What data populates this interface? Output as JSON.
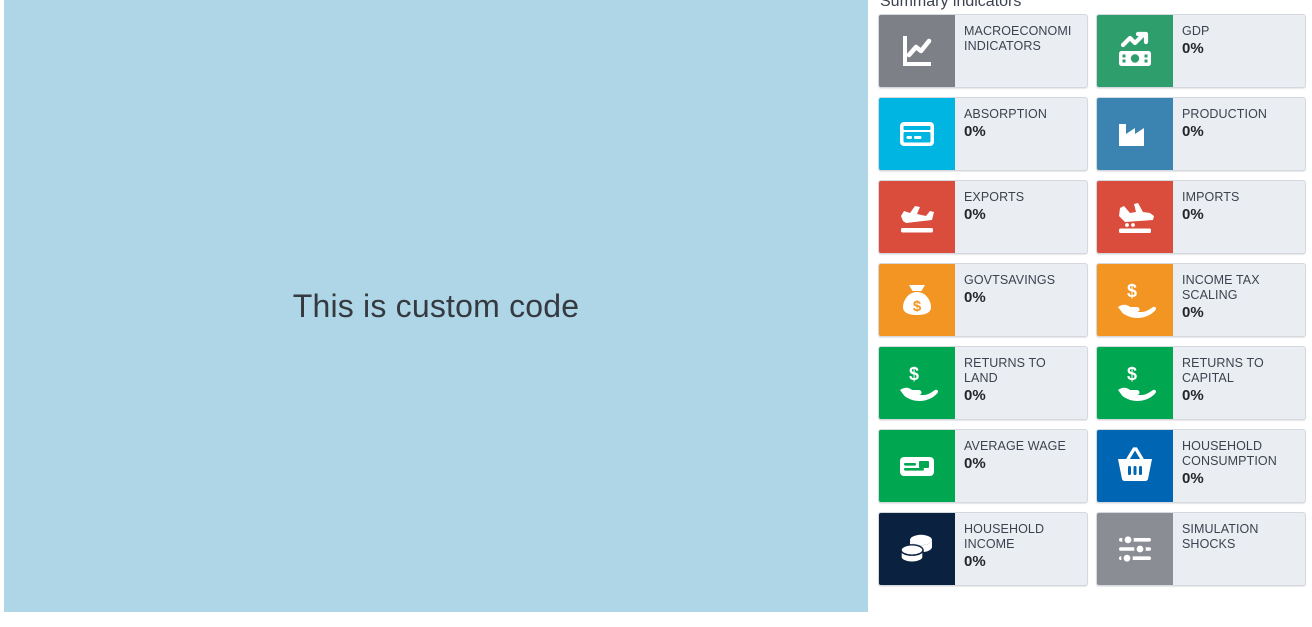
{
  "custom_panel": {
    "text": "This is custom code",
    "background": "#aed6e6"
  },
  "summary": {
    "title": "Summary indicators",
    "tiles": [
      {
        "id": "macroeconomic-indicators",
        "label": "MACROECONOMI\nINDICATORS",
        "value": "",
        "icon": "line-chart-icon",
        "color": "#7d8087"
      },
      {
        "id": "gdp",
        "label": "GDP",
        "value": "0%",
        "icon": "money-bill-trend-icon",
        "color": "#2e9e6c"
      },
      {
        "id": "absorption",
        "label": "ABSORPTION",
        "value": "0%",
        "icon": "credit-card-icon",
        "color": "#00b5e2"
      },
      {
        "id": "production",
        "label": "PRODUCTION",
        "value": "0%",
        "icon": "factory-icon",
        "color": "#3b83b0"
      },
      {
        "id": "exports",
        "label": "EXPORTS",
        "value": "0%",
        "icon": "plane-departure-icon",
        "color": "#da4c3c"
      },
      {
        "id": "imports",
        "label": "IMPORTS",
        "value": "0%",
        "icon": "plane-arrival-icon",
        "color": "#da4c3c"
      },
      {
        "id": "govtsavings",
        "label": "GOVTSAVINGS",
        "value": "0%",
        "icon": "money-bag-icon",
        "color": "#f29523"
      },
      {
        "id": "income-tax-scaling",
        "label": "INCOME TAX\nSCALING",
        "value": "0%",
        "icon": "hand-holding-dollar-icon",
        "color": "#f29523"
      },
      {
        "id": "returns-to-land",
        "label": "RETURNS TO\nLAND",
        "value": "0%",
        "icon": "hand-holding-dollar-icon",
        "color": "#00a650"
      },
      {
        "id": "returns-to-capital",
        "label": "RETURNS TO\nCAPITAL",
        "value": "0%",
        "icon": "hand-holding-dollar-icon",
        "color": "#00a650"
      },
      {
        "id": "average-wage",
        "label": "AVERAGE WAGE",
        "value": "0%",
        "icon": "id-card-icon",
        "color": "#00a650"
      },
      {
        "id": "household-consumption",
        "label": "HOUSEHOLD\nCONSUMPTION",
        "value": "0%",
        "icon": "shopping-basket-icon",
        "color": "#0066b3"
      },
      {
        "id": "household-income",
        "label": "HOUSEHOLD\nINCOME",
        "value": "0%",
        "icon": "coins-stack-icon",
        "color": "#0a2240"
      },
      {
        "id": "simulation-shocks",
        "label": "SIMULATION\nSHOCKS",
        "value": "",
        "icon": "sliders-icon",
        "color": "#8a8d93"
      }
    ]
  }
}
